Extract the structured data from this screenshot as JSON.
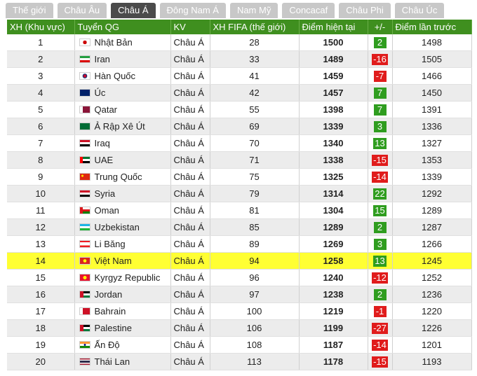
{
  "tabs": [
    {
      "label": "Thế giới",
      "active": false
    },
    {
      "label": "Châu Âu",
      "active": false
    },
    {
      "label": "Châu Á",
      "active": true
    },
    {
      "label": "Đông Nam Á",
      "active": false
    },
    {
      "label": "Nam Mỹ",
      "active": false
    },
    {
      "label": "Concacaf",
      "active": false
    },
    {
      "label": "Châu Phi",
      "active": false
    },
    {
      "label": "Châu Úc",
      "active": false
    }
  ],
  "table": {
    "headers": [
      "XH (Khu vực)",
      "Tuyển QG",
      "KV",
      "XH FIFA (thế giới)",
      "Điểm hiện tại",
      "+/-",
      "Điểm lần trước"
    ],
    "rows": [
      {
        "rank": "1",
        "team": "Nhật Bản",
        "region": "Châu Á",
        "fifa": "28",
        "points": "1500",
        "change": "2",
        "dir": "up",
        "prev": "1498",
        "flag": "japan-flag",
        "highlight": false
      },
      {
        "rank": "2",
        "team": "Iran",
        "region": "Châu Á",
        "fifa": "33",
        "points": "1489",
        "change": "-16",
        "dir": "down",
        "prev": "1505",
        "flag": "iran-flag",
        "highlight": false
      },
      {
        "rank": "3",
        "team": "Hàn Quốc",
        "region": "Châu Á",
        "fifa": "41",
        "points": "1459",
        "change": "-7",
        "dir": "down",
        "prev": "1466",
        "flag": "south-korea-flag",
        "highlight": false
      },
      {
        "rank": "4",
        "team": "Úc",
        "region": "Châu Á",
        "fifa": "42",
        "points": "1457",
        "change": "7",
        "dir": "up",
        "prev": "1450",
        "flag": "australia-flag",
        "highlight": false
      },
      {
        "rank": "5",
        "team": "Qatar",
        "region": "Châu Á",
        "fifa": "55",
        "points": "1398",
        "change": "7",
        "dir": "up",
        "prev": "1391",
        "flag": "qatar-flag",
        "highlight": false
      },
      {
        "rank": "6",
        "team": "Ả Rập Xê Út",
        "region": "Châu Á",
        "fifa": "69",
        "points": "1339",
        "change": "3",
        "dir": "up",
        "prev": "1336",
        "flag": "saudi-arabia-flag",
        "highlight": false
      },
      {
        "rank": "7",
        "team": "Iraq",
        "region": "Châu Á",
        "fifa": "70",
        "points": "1340",
        "change": "13",
        "dir": "up",
        "prev": "1327",
        "flag": "iraq-flag",
        "highlight": false
      },
      {
        "rank": "8",
        "team": "UAE",
        "region": "Châu Á",
        "fifa": "71",
        "points": "1338",
        "change": "-15",
        "dir": "down",
        "prev": "1353",
        "flag": "uae-flag",
        "highlight": false
      },
      {
        "rank": "9",
        "team": "Trung Quốc",
        "region": "Châu Á",
        "fifa": "75",
        "points": "1325",
        "change": "-14",
        "dir": "down",
        "prev": "1339",
        "flag": "china-flag",
        "highlight": false
      },
      {
        "rank": "10",
        "team": "Syria",
        "region": "Châu Á",
        "fifa": "79",
        "points": "1314",
        "change": "22",
        "dir": "up",
        "prev": "1292",
        "flag": "syria-flag",
        "highlight": false
      },
      {
        "rank": "11",
        "team": "Oman",
        "region": "Châu Á",
        "fifa": "81",
        "points": "1304",
        "change": "15",
        "dir": "up",
        "prev": "1289",
        "flag": "oman-flag",
        "highlight": false
      },
      {
        "rank": "12",
        "team": "Uzbekistan",
        "region": "Châu Á",
        "fifa": "85",
        "points": "1289",
        "change": "2",
        "dir": "up",
        "prev": "1287",
        "flag": "uzbekistan-flag",
        "highlight": false
      },
      {
        "rank": "13",
        "team": "Li Băng",
        "region": "Châu Á",
        "fifa": "89",
        "points": "1269",
        "change": "3",
        "dir": "up",
        "prev": "1266",
        "flag": "lebanon-flag",
        "highlight": false
      },
      {
        "rank": "14",
        "team": "Việt Nam",
        "region": "Châu Á",
        "fifa": "94",
        "points": "1258",
        "change": "13",
        "dir": "up",
        "prev": "1245",
        "flag": "vietnam-flag",
        "highlight": true
      },
      {
        "rank": "15",
        "team": "Kyrgyz Republic",
        "region": "Châu Á",
        "fifa": "96",
        "points": "1240",
        "change": "-12",
        "dir": "down",
        "prev": "1252",
        "flag": "kyrgyzstan-flag",
        "highlight": false
      },
      {
        "rank": "16",
        "team": "Jordan",
        "region": "Châu Á",
        "fifa": "97",
        "points": "1238",
        "change": "2",
        "dir": "up",
        "prev": "1236",
        "flag": "jordan-flag",
        "highlight": false
      },
      {
        "rank": "17",
        "team": "Bahrain",
        "region": "Châu Á",
        "fifa": "100",
        "points": "1219",
        "change": "-1",
        "dir": "down",
        "prev": "1220",
        "flag": "bahrain-flag",
        "highlight": false
      },
      {
        "rank": "18",
        "team": "Palestine",
        "region": "Châu Á",
        "fifa": "106",
        "points": "1199",
        "change": "-27",
        "dir": "down",
        "prev": "1226",
        "flag": "palestine-flag",
        "highlight": false
      },
      {
        "rank": "19",
        "team": "Ấn Độ",
        "region": "Châu Á",
        "fifa": "108",
        "points": "1187",
        "change": "-14",
        "dir": "down",
        "prev": "1201",
        "flag": "india-flag",
        "highlight": false
      },
      {
        "rank": "20",
        "team": "Thái Lan",
        "region": "Châu Á",
        "fifa": "113",
        "points": "1178",
        "change": "-15",
        "dir": "down",
        "prev": "1193",
        "flag": "thailand-flag",
        "highlight": false
      }
    ]
  },
  "colors": {
    "header_bg": "#3f8f1f",
    "tab_bg": "#c8c8c8",
    "tab_active_bg": "#4b4b4b",
    "row_alt_bg": "#ececec",
    "highlight_bg": "#ffff33",
    "change_up": "#2f9d1f",
    "change_down": "#e01c1c"
  }
}
